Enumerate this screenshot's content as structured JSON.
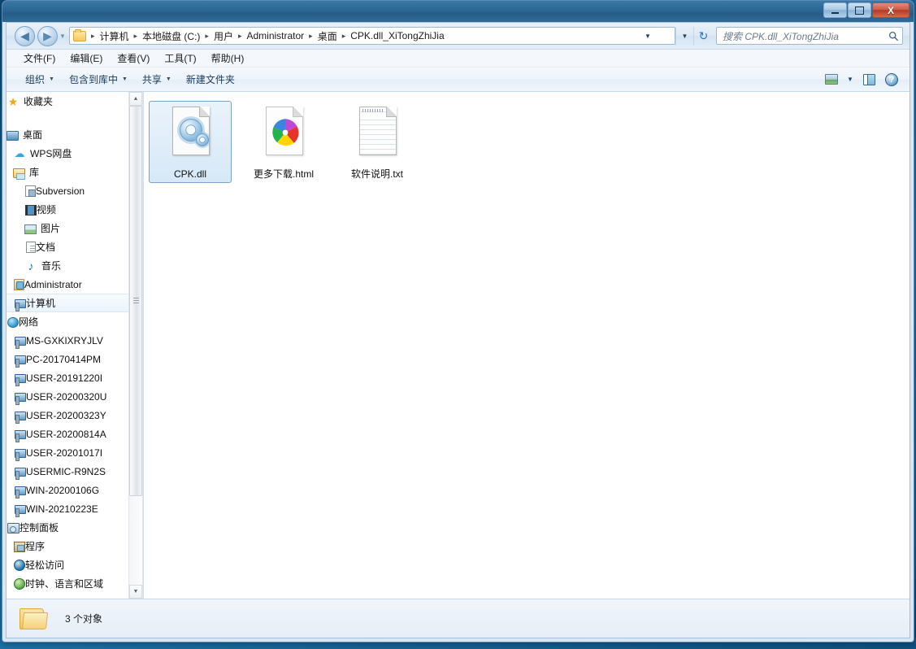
{
  "window": {
    "title": "",
    "buttons": {
      "minimize": "–",
      "maximize": "☐",
      "close": "X"
    }
  },
  "address_bar": {
    "back_glyph": "◀",
    "forward_glyph": "▶",
    "history_caret": "▼",
    "breadcrumbs": [
      "计算机",
      "本地磁盘 (C:)",
      "用户",
      "Administrator",
      "桌面",
      "CPK.dll_XiTongZhiJia"
    ],
    "separator": "▸",
    "dropdown_caret": "▼",
    "refresh_glyph": "↻",
    "search": {
      "placeholder": "搜索 CPK.dll_XiTongZhiJia",
      "value": "",
      "icon": "⚲"
    }
  },
  "menubar": {
    "items": [
      "文件(F)",
      "编辑(E)",
      "查看(V)",
      "工具(T)",
      "帮助(H)"
    ]
  },
  "commandbar": {
    "items": [
      {
        "label": "组织",
        "caret": "▼"
      },
      {
        "label": "包含到库中",
        "caret": "▼"
      },
      {
        "label": "共享",
        "caret": "▼"
      },
      {
        "label": "新建文件夹",
        "caret": ""
      }
    ],
    "right_icons": [
      "view-icon",
      "view-dropdown-caret",
      "preview-pane-icon",
      "help-icon"
    ],
    "view_caret": "▼",
    "help_glyph": "?"
  },
  "navpane": {
    "items": [
      {
        "label": "收藏夹",
        "icon": "favorites-star-icon",
        "indent": 0,
        "icon_class": "ico-star",
        "glyph": "★",
        "selected": false,
        "spacer_after": true
      },
      {
        "label": "桌面",
        "icon": "desktop-icon",
        "indent": 0,
        "icon_class": "ico-desktop",
        "glyph": "",
        "selected": false
      },
      {
        "label": "WPS网盘",
        "icon": "cloud-icon",
        "indent": 1,
        "icon_class": "ico-cloud",
        "glyph": "☁",
        "selected": false
      },
      {
        "label": "库",
        "icon": "library-icon",
        "indent": 1,
        "icon_class": "ico-lib",
        "glyph": "",
        "selected": false
      },
      {
        "label": "Subversion",
        "icon": "subversion-icon",
        "indent": 2,
        "icon_class": "ico-svn",
        "glyph": "",
        "selected": false
      },
      {
        "label": "视频",
        "icon": "videos-icon",
        "indent": 2,
        "icon_class": "ico-video",
        "glyph": "",
        "selected": false
      },
      {
        "label": "图片",
        "icon": "pictures-icon",
        "indent": 2,
        "icon_class": "ico-pic",
        "glyph": "",
        "selected": false
      },
      {
        "label": "文档",
        "icon": "documents-icon",
        "indent": 2,
        "icon_class": "ico-doc",
        "glyph": "",
        "selected": false
      },
      {
        "label": "音乐",
        "icon": "music-icon",
        "indent": 2,
        "icon_class": "ico-music",
        "glyph": "♪",
        "selected": false
      },
      {
        "label": "Administrator",
        "icon": "user-folder-icon",
        "indent": 1,
        "icon_class": "ico-user",
        "glyph": "",
        "selected": false
      },
      {
        "label": "计算机",
        "icon": "computer-icon",
        "indent": 1,
        "icon_class": "ico-pc",
        "glyph": "",
        "selected": true
      },
      {
        "label": "网络",
        "icon": "network-icon",
        "indent": 0,
        "icon_class": "ico-net",
        "glyph": "",
        "selected": false
      },
      {
        "label": "MS-GXKIXRYJLV",
        "icon": "network-computer-icon",
        "indent": 1,
        "icon_class": "ico-pc",
        "glyph": "",
        "selected": false
      },
      {
        "label": "PC-20170414PM",
        "icon": "network-computer-icon",
        "indent": 1,
        "icon_class": "ico-pc",
        "glyph": "",
        "selected": false
      },
      {
        "label": "USER-20191220I",
        "icon": "network-computer-icon",
        "indent": 1,
        "icon_class": "ico-pc",
        "glyph": "",
        "selected": false
      },
      {
        "label": "USER-20200320U",
        "icon": "network-computer-icon",
        "indent": 1,
        "icon_class": "ico-pc",
        "glyph": "",
        "selected": false
      },
      {
        "label": "USER-20200323Y",
        "icon": "network-computer-icon",
        "indent": 1,
        "icon_class": "ico-pc",
        "glyph": "",
        "selected": false
      },
      {
        "label": "USER-20200814A",
        "icon": "network-computer-icon",
        "indent": 1,
        "icon_class": "ico-pc",
        "glyph": "",
        "selected": false
      },
      {
        "label": "USER-20201017I",
        "icon": "network-computer-icon",
        "indent": 1,
        "icon_class": "ico-pc",
        "glyph": "",
        "selected": false
      },
      {
        "label": "USERMIC-R9N2S",
        "icon": "network-computer-icon",
        "indent": 1,
        "icon_class": "ico-pc",
        "glyph": "",
        "selected": false
      },
      {
        "label": "WIN-20200106G",
        "icon": "network-computer-icon",
        "indent": 1,
        "icon_class": "ico-pc",
        "glyph": "",
        "selected": false
      },
      {
        "label": "WIN-20210223E",
        "icon": "network-computer-icon",
        "indent": 1,
        "icon_class": "ico-pc",
        "glyph": "",
        "selected": false
      },
      {
        "label": "控制面板",
        "icon": "control-panel-icon",
        "indent": 0,
        "icon_class": "ico-cp",
        "glyph": "",
        "selected": false
      },
      {
        "label": "程序",
        "icon": "programs-icon",
        "indent": 1,
        "icon_class": "ico-prog",
        "glyph": "",
        "selected": false
      },
      {
        "label": "轻松访问",
        "icon": "ease-of-access-icon",
        "indent": 1,
        "icon_class": "ico-ease",
        "glyph": "",
        "selected": false
      },
      {
        "label": "时钟、语言和区域",
        "icon": "clock-language-region-icon",
        "indent": 1,
        "icon_class": "ico-clock",
        "glyph": "",
        "selected": false
      }
    ],
    "scroll_up_glyph": "▲",
    "scroll_down_glyph": "▼"
  },
  "files": [
    {
      "name": "CPK.dll",
      "type": "dll",
      "selected": true
    },
    {
      "name": "更多下载.html",
      "type": "html",
      "selected": false
    },
    {
      "name": "软件说明.txt",
      "type": "txt",
      "selected": false
    }
  ],
  "statusbar": {
    "text": "3 个对象",
    "icon": "folder-icon"
  },
  "colors": {
    "titlebar": "#2c6693",
    "accent": "#2f73b0",
    "selection_border": "#7da2c4",
    "close_button": "#c44a30"
  }
}
